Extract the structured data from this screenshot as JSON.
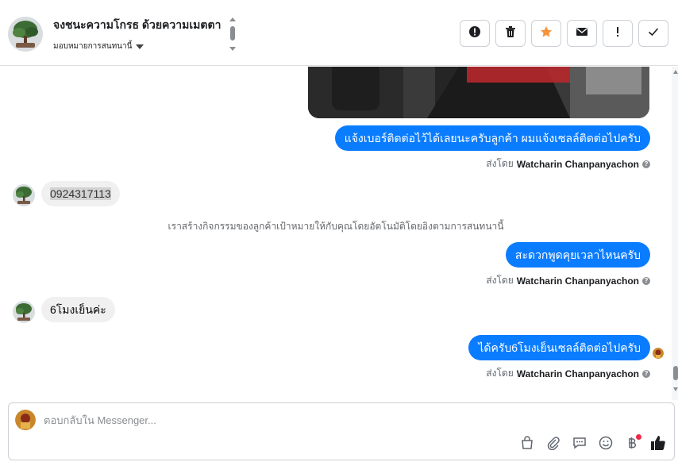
{
  "header": {
    "contact_name": "จงชนะความโกรธ ด้วยความเมตตา",
    "assign_label": "มอบหมายการสนทนานี้",
    "actions": [
      "mark-spam-icon",
      "delete-icon",
      "star-icon",
      "mail-icon",
      "exclamation-icon",
      "check-icon"
    ]
  },
  "chat": {
    "messages": [
      {
        "direction": "out",
        "text": "แจ้งเบอร์ติดต่อไว้ได้เลยนะครับลูกค้า ผมแจ้งเซลล์ติดต่อไปครับ"
      },
      {
        "direction": "in",
        "text": "0924317113"
      },
      {
        "direction": "out",
        "text": "สะดวกพูดคุยเวลาไหนครับ"
      },
      {
        "direction": "in",
        "text": "6โมงเย็นค่ะ"
      },
      {
        "direction": "out",
        "text": "ได้ครับ6โมงเย็นเซลล์ติดต่อไปครับ"
      }
    ],
    "sent_by_prefix": "ส่งโดย",
    "sent_by_name": "Watcharin Chanpanyachon",
    "help_glyph": "?",
    "system_message": "เราสร้างกิจกรรมของลูกค้าเป้าหมายให้กับคุณโดยอัตโนมัติโดยอิงตามการสนทนานี้"
  },
  "composer": {
    "placeholder": "ตอบกลับใน Messenger...",
    "tools": [
      "shopping-bag-icon",
      "attachment-icon",
      "saved-replies-icon",
      "emoji-icon",
      "baht-icon",
      "like-icon"
    ]
  },
  "colors": {
    "accent": "#0a7cff",
    "incoming_bubble": "#f0f0f0",
    "star": "#f7923a",
    "notification_dot": "#f02849"
  }
}
